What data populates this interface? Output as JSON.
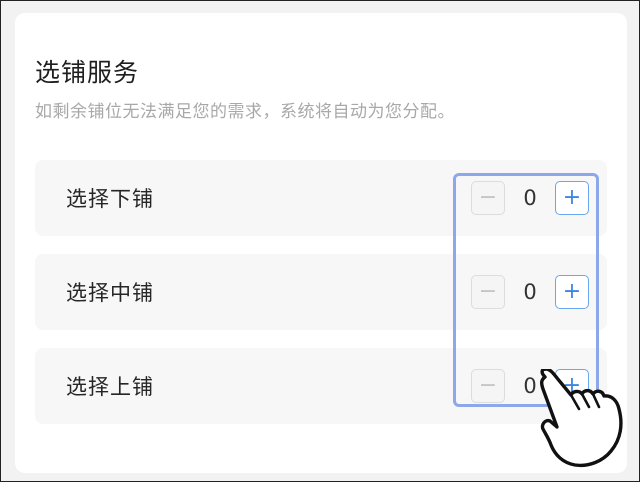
{
  "service": {
    "title": "选铺服务",
    "subtitle": "如剩余铺位无法满足您的需求，系统将自动为您分配。"
  },
  "berths": [
    {
      "label": "选择下铺",
      "quantity": "0",
      "minus_symbol": "−",
      "plus_symbol": "+"
    },
    {
      "label": "选择中铺",
      "quantity": "0",
      "minus_symbol": "−",
      "plus_symbol": "+"
    },
    {
      "label": "选择上铺",
      "quantity": "0",
      "minus_symbol": "−",
      "plus_symbol": "+"
    }
  ],
  "colors": {
    "accent": "#3d86e6",
    "highlight": "#8ca7ea",
    "subtitle": "#a8a8a8",
    "row_background": "#f7f7f7"
  },
  "icons": {
    "minus": "minus-icon",
    "plus": "plus-icon",
    "pointer": "pointing-hand-icon"
  }
}
